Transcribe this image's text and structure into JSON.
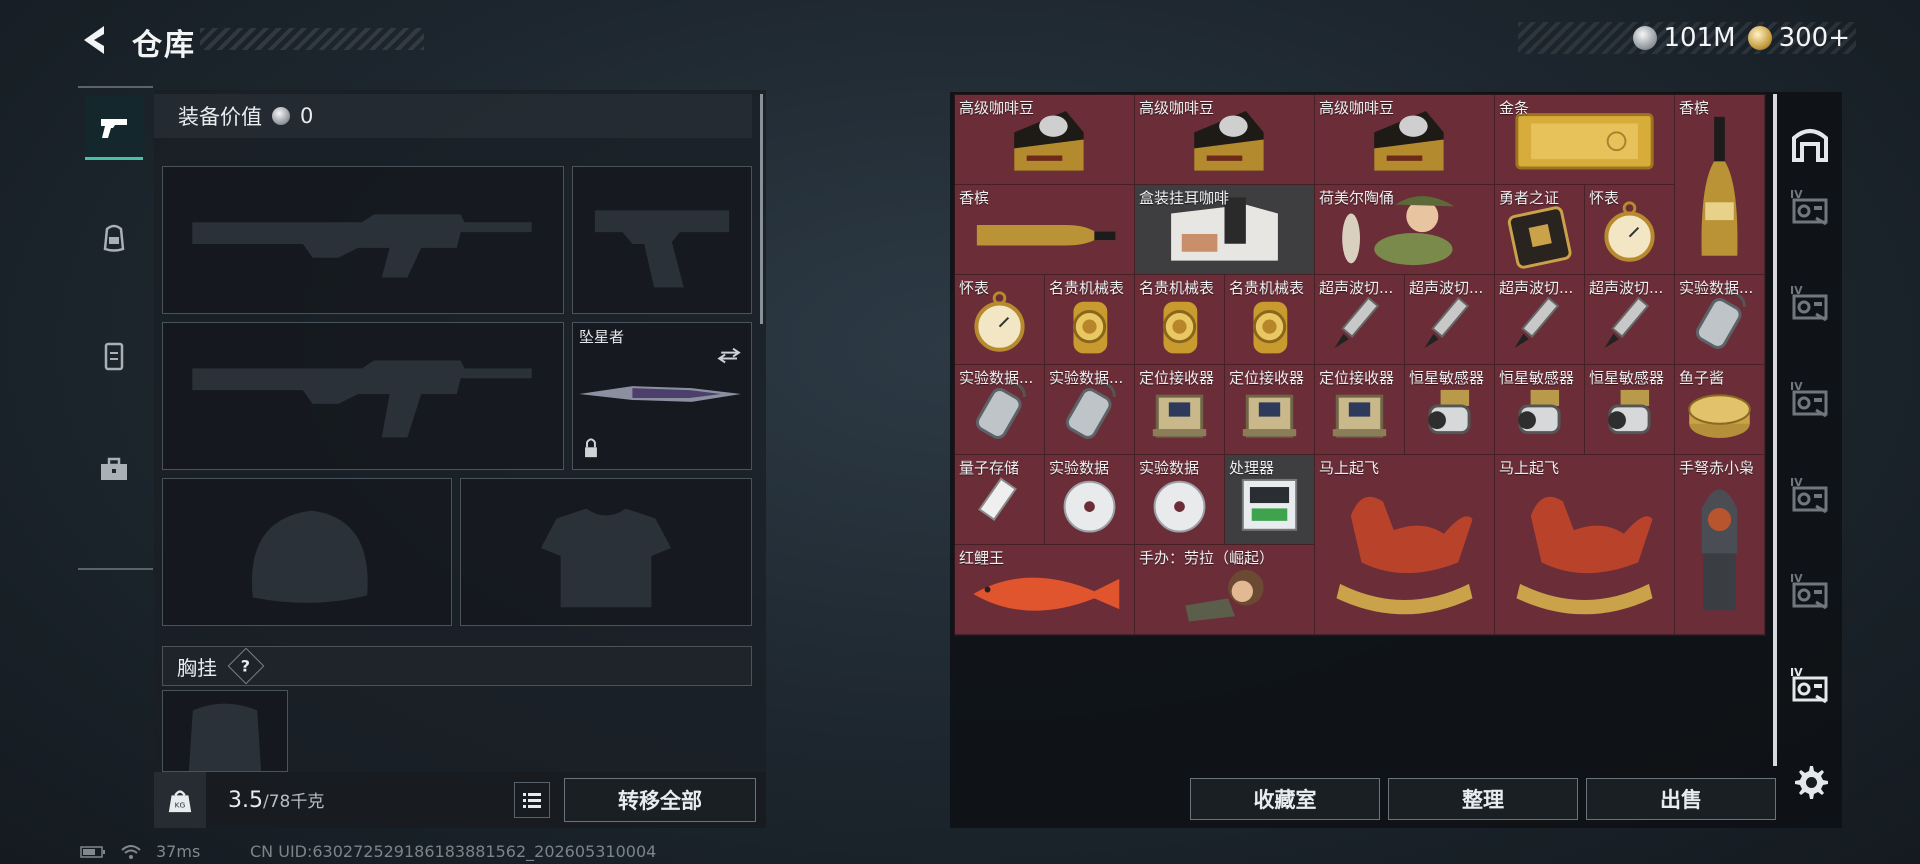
{
  "header": {
    "title": "仓库",
    "back_icon": "chevron-left-icon"
  },
  "currency": {
    "silver": "101M",
    "gold": "300+"
  },
  "nav_tabs": [
    "pistol-icon",
    "backpack-icon",
    "vest-icon",
    "toolbox-icon"
  ],
  "equipment": {
    "value_label": "装备价值",
    "value": "0",
    "melee_label": "坠星者",
    "chest_label": "胸挂",
    "chest_hint": "?"
  },
  "capacity": {
    "current": "3.5",
    "max": "/78千克"
  },
  "transfer_all": "转移全部",
  "items": [
    {
      "label": "高级咖啡豆",
      "icon": "coffee-bag"
    },
    {
      "label": "高级咖啡豆",
      "icon": "coffee-bag"
    },
    {
      "label": "高级咖啡豆",
      "icon": "coffee-bag"
    },
    {
      "label": "金条",
      "icon": "gold-bar"
    },
    {
      "label": "香槟",
      "icon": "champagne-bottle"
    },
    {
      "label": "香槟",
      "icon": "champagne-bottle"
    },
    {
      "label": "盒装挂耳咖啡",
      "icon": "coffee-box"
    },
    {
      "label": "荷美尔陶俑",
      "icon": "figurine"
    },
    {
      "label": "勇者之证",
      "icon": "medal-card"
    },
    {
      "label": "怀表",
      "icon": "pocket-watch"
    },
    {
      "label": "怀表",
      "icon": "pocket-watch"
    },
    {
      "label": "名贵机械表",
      "icon": "wristwatch"
    },
    {
      "label": "名贵机械表",
      "icon": "wristwatch"
    },
    {
      "label": "名贵机械表",
      "icon": "wristwatch"
    },
    {
      "label": "超声波切...",
      "icon": "ultrasonic-cutter"
    },
    {
      "label": "超声波切...",
      "icon": "ultrasonic-cutter"
    },
    {
      "label": "超声波切...",
      "icon": "ultrasonic-cutter"
    },
    {
      "label": "超声波切...",
      "icon": "ultrasonic-cutter"
    },
    {
      "label": "实验数据...",
      "icon": "data-canister"
    },
    {
      "label": "实验数据...",
      "icon": "data-canister"
    },
    {
      "label": "实验数据...",
      "icon": "data-canister"
    },
    {
      "label": "定位接收器",
      "icon": "receiver"
    },
    {
      "label": "定位接收器",
      "icon": "receiver"
    },
    {
      "label": "定位接收器",
      "icon": "receiver"
    },
    {
      "label": "恒星敏感器",
      "icon": "sensor"
    },
    {
      "label": "恒星敏感器",
      "icon": "sensor"
    },
    {
      "label": "恒星敏感器",
      "icon": "sensor"
    },
    {
      "label": "鱼子酱",
      "icon": "caviar-tin"
    },
    {
      "label": "量子存储",
      "icon": "usb-drive"
    },
    {
      "label": "实验数据",
      "icon": "disc"
    },
    {
      "label": "实验数据",
      "icon": "disc"
    },
    {
      "label": "处理器",
      "icon": "processor"
    },
    {
      "label": "马上起飞",
      "icon": "horse-statue"
    },
    {
      "label": "马上起飞",
      "icon": "horse-statue"
    },
    {
      "label": "手弩赤小枭",
      "icon": "hooded-figure"
    },
    {
      "label": "红鲤王",
      "icon": "red-carp"
    },
    {
      "label": "手办：劳拉（崛起）",
      "icon": "lara-figure"
    }
  ],
  "side_icons": [
    "vault-icon",
    "storage-1-icon",
    "storage-2-icon",
    "storage-3-icon",
    "storage-4-icon",
    "storage-5-icon",
    "storage-6-icon"
  ],
  "actions": {
    "collection": "收藏室",
    "sort": "整理",
    "sell": "出售"
  },
  "status": {
    "ping": "37ms",
    "uid": "CN UID:630272529186183881562_202605310004"
  }
}
